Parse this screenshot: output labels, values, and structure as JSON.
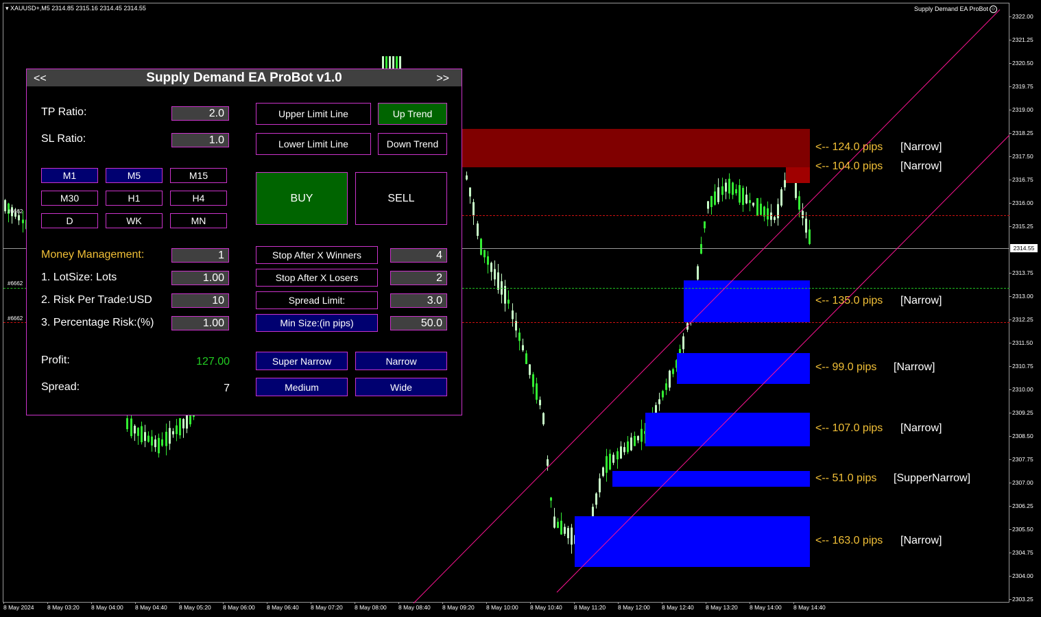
{
  "chart": {
    "symbol_info": "XAUUSD+,M5  2314.85 2315.16 2314.45 2314.55",
    "bot_label": "Supply Demand EA ProBot",
    "current_price": "2314.55",
    "price_ticks": [
      "2322.00",
      "2321.25",
      "2320.50",
      "2319.75",
      "2319.00",
      "2318.25",
      "2317.50",
      "2316.75",
      "2316.00",
      "2315.25",
      "2313.75",
      "2313.00",
      "2312.25",
      "2311.50",
      "2310.75",
      "2310.00",
      "2309.25",
      "2308.50",
      "2307.75",
      "2307.00",
      "2306.25",
      "2305.50",
      "2304.75",
      "2304.00",
      "2303.25"
    ],
    "time_ticks": [
      "8 May 2024",
      "8 May 03:20",
      "8 May 04:00",
      "8 May 04:40",
      "8 May 05:20",
      "8 May 06:00",
      "8 May 06:40",
      "8 May 07:20",
      "8 May 08:00",
      "8 May 08:40",
      "8 May 09:20",
      "8 May 10:00",
      "8 May 10:40",
      "8 May 11:20",
      "8 May 12:00",
      "8 May 12:40",
      "8 May 13:20",
      "8 May 14:00",
      "8 May 14:40"
    ],
    "trade_tags": [
      "#6662",
      "#6662",
      "#6662"
    ],
    "zones": [
      {
        "kind": "supply",
        "pips": "<-- 124.0 pips",
        "type": "[Narrow]"
      },
      {
        "kind": "supply",
        "pips": "<-- 104.0 pips",
        "type": "[Narrow]"
      },
      {
        "kind": "demand",
        "pips": "<-- 135.0 pips",
        "type": "[Narrow]"
      },
      {
        "kind": "demand",
        "pips": "<-- 99.0 pips",
        "type": "[Narrow]"
      },
      {
        "kind": "demand",
        "pips": "<-- 107.0 pips",
        "type": "[Narrow]"
      },
      {
        "kind": "demand",
        "pips": "<-- 51.0 pips",
        "type": "[SupperNarrow]"
      },
      {
        "kind": "demand",
        "pips": "<-- 163.0 pips",
        "type": "[Narrow]"
      }
    ],
    "colors": {
      "supply": "#800000",
      "supply_light": "#a00000",
      "demand": "#0000ff",
      "bull": "#c8ffc8",
      "bear": "#33ee33",
      "trendline": "#ff1493",
      "pips_text": "#f2c037"
    }
  },
  "panel": {
    "title": "Supply Demand EA ProBot v1.0",
    "nav_prev": "<<",
    "nav_next": ">>",
    "tp_label": "TP Ratio:",
    "tp_value": "2.0",
    "sl_label": "SL Ratio:",
    "sl_value": "1.0",
    "upper_limit": "Upper Limit Line",
    "lower_limit": "Lower Limit Line",
    "up_trend": "Up Trend",
    "down_trend": "Down Trend",
    "timeframes": [
      "M1",
      "M5",
      "M15",
      "M30",
      "H1",
      "H4",
      "D",
      "WK",
      "MN"
    ],
    "buy": "BUY",
    "sell": "SELL",
    "mm_label": "Money Management:",
    "mm_value": "1",
    "lot_label": "1. LotSize: Lots",
    "lot_value": "1.00",
    "risk_label": "2. Risk Per Trade:USD",
    "risk_value": "10",
    "pct_label": "3. Percentage Risk:(%)",
    "pct_value": "1.00",
    "stop_winners": "Stop After X Winners",
    "stop_winners_value": "4",
    "stop_losers": "Stop After X Losers",
    "stop_losers_value": "2",
    "spread_limit": "Spread Limit:",
    "spread_limit_value": "3.0",
    "min_size": "Min Size:(in pips)",
    "min_size_value": "50.0",
    "profit_label": "Profit:",
    "profit_value": "127.00",
    "spread_label": "Spread:",
    "spread_value": "7",
    "super_narrow": "Super Narrow",
    "narrow": "Narrow",
    "medium": "Medium",
    "wide": "Wide"
  }
}
